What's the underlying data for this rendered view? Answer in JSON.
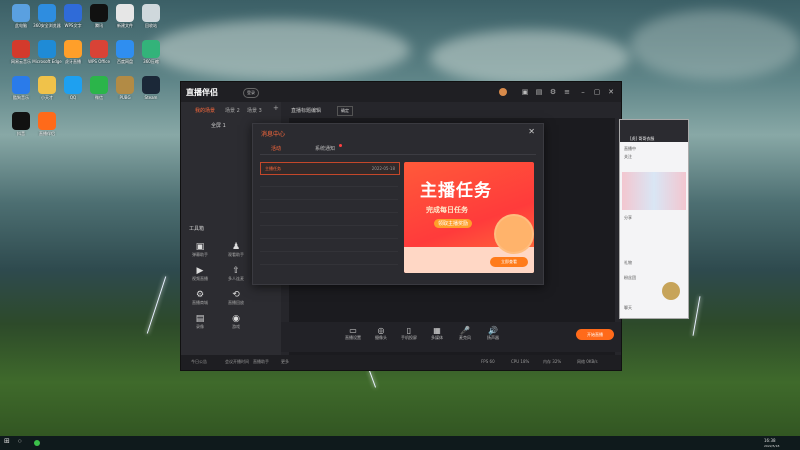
{
  "desktop": {
    "icons": [
      {
        "label": "此电脑",
        "color": "#5aa0e0"
      },
      {
        "label": "360安全浏览器",
        "color": "#2e8de0"
      },
      {
        "label": "WPS文字",
        "color": "#2f6bd8"
      },
      {
        "label": "腾讯",
        "color": "#111111"
      },
      {
        "label": "新建文件",
        "color": "#e6e6e6"
      },
      {
        "label": "回收站",
        "color": "#cfd8dc"
      },
      {
        "label": "网易云音乐",
        "color": "#d33a2c"
      },
      {
        "label": "Microsoft Edge",
        "color": "#1f8bd6"
      },
      {
        "label": "虎牙直播",
        "color": "#ff9f2a"
      },
      {
        "label": "WPS Office",
        "color": "#d84336"
      },
      {
        "label": "百度网盘",
        "color": "#2f8ef0"
      },
      {
        "label": "360压缩",
        "color": "#33b37a"
      },
      {
        "label": "酷狗音乐",
        "color": "#2a7bea"
      },
      {
        "label": "小天才",
        "color": "#f0c24a"
      },
      {
        "label": "QQ",
        "color": "#1ea0f0"
      },
      {
        "label": "微信",
        "color": "#2bb54a"
      },
      {
        "label": "PUBG",
        "color": "#b28b45"
      },
      {
        "label": "Steam",
        "color": "#1b2838"
      },
      {
        "label": "抖音",
        "color": "#111111"
      },
      {
        "label": "直播伴侣",
        "color": "#ff6a1a"
      }
    ]
  },
  "window": {
    "app_title": "直播伴侣",
    "badge": "登录",
    "tabs": [
      "我的场景",
      "场景 2",
      "场景 3"
    ],
    "add_tab": "+",
    "scene_label": "全屏 1",
    "stream_title_label": "直播标题编辑",
    "stream_title_btn": "确定",
    "tools_header": "工具箱",
    "tools": [
      {
        "label": "弹幕助手",
        "glyph": "▣"
      },
      {
        "label": "观看助手",
        "glyph": "♟"
      },
      {
        "label": "视频直播",
        "glyph": "▶"
      },
      {
        "label": "多人连麦",
        "glyph": "⇧"
      },
      {
        "label": "直播商城",
        "glyph": "⚙"
      },
      {
        "label": "直播回放",
        "glyph": "⟲"
      },
      {
        "label": "录像",
        "glyph": "▤"
      },
      {
        "label": "游戏",
        "glyph": "◉"
      }
    ],
    "bottom_buttons": [
      {
        "label": "直播设置",
        "glyph": "▭"
      },
      {
        "label": "摄像头",
        "glyph": "◎"
      },
      {
        "label": "手机投屏",
        "glyph": "▯"
      },
      {
        "label": "多媒体",
        "glyph": "▦"
      },
      {
        "label": "麦克风",
        "glyph": "🎤"
      },
      {
        "label": "扬声器",
        "glyph": "🔊"
      }
    ],
    "start_button": "开始直播",
    "status": [
      "今日公告",
      "会议开播时间",
      "直播助手",
      "更多",
      "FPS 60",
      "CPU 18%",
      "内存 32%",
      "网络 0KB/s"
    ]
  },
  "dialog": {
    "title": "消息中心",
    "close": "✕",
    "tabs": [
      "活动",
      "系统通知"
    ],
    "active_tab_index": 0,
    "messages": [
      {
        "title": "主播任务",
        "date": "2022-05-18"
      }
    ],
    "banner": {
      "title": "主播任务",
      "subtitle": "完成每日任务",
      "pill": "领取主播奖励",
      "button": "立即查看"
    }
  },
  "side_window": {
    "title": "[虎] 哥哥衣服",
    "lines": [
      "直播中",
      "关注",
      "分享",
      "礼物",
      "粉丝团",
      "聊天"
    ]
  },
  "taskbar": {
    "clock": "16:38",
    "date": "2022/5/18"
  }
}
